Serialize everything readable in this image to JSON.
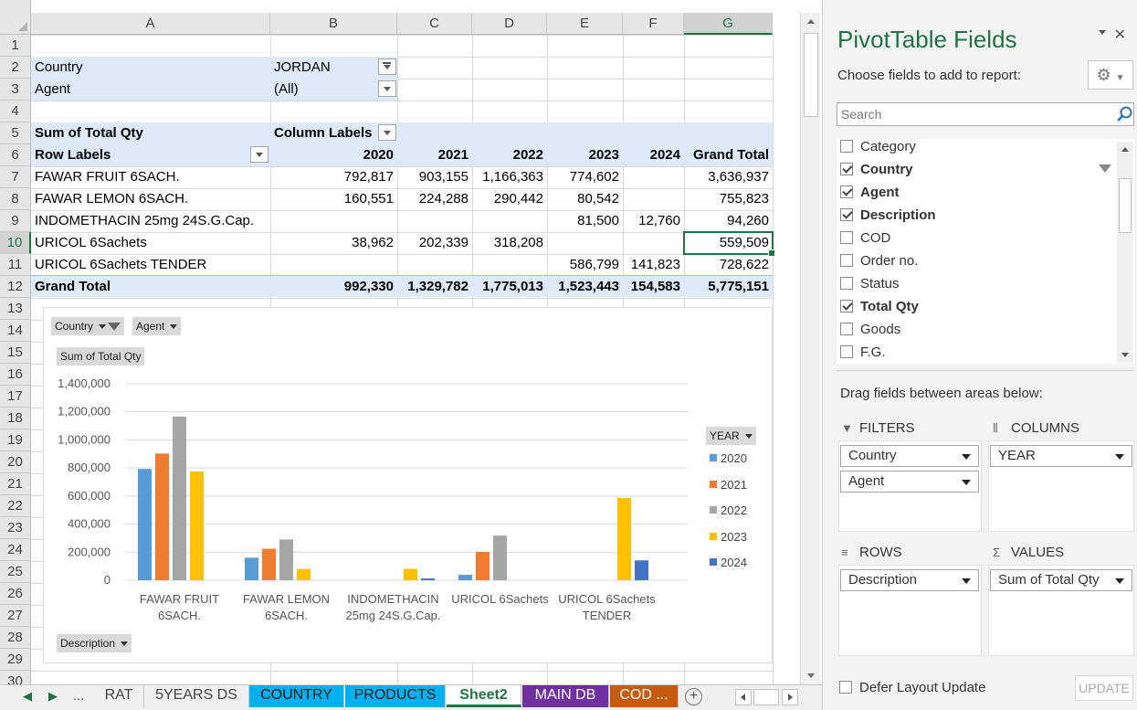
{
  "columns": [
    "A",
    "B",
    "C",
    "D",
    "E",
    "F",
    "G"
  ],
  "rows": [
    "1",
    "2",
    "3",
    "4",
    "5",
    "6",
    "7",
    "8",
    "9",
    "10",
    "11",
    "12",
    "13",
    "14",
    "15",
    "16",
    "17",
    "18",
    "19",
    "20",
    "21",
    "22",
    "23",
    "24",
    "25",
    "26",
    "27",
    "28",
    "29",
    "30"
  ],
  "filters": [
    {
      "label": "Country",
      "value": "JORDAN"
    },
    {
      "label": "Agent",
      "value": "(All)"
    }
  ],
  "pivot": {
    "sum_label": "Sum of Total Qty",
    "column_labels": "Column Labels",
    "row_labels": "Row Labels",
    "years": [
      "2020",
      "2021",
      "2022",
      "2023",
      "2024"
    ],
    "grand_total_header": "Grand Total",
    "rows": [
      {
        "label": "FAWAR FRUIT 6SACH.",
        "values": [
          "792,817",
          "903,155",
          "1,166,363",
          "774,602",
          ""
        ],
        "total": "3,636,937"
      },
      {
        "label": "FAWAR LEMON 6SACH.",
        "values": [
          "160,551",
          "224,288",
          "290,442",
          "80,542",
          ""
        ],
        "total": "755,823"
      },
      {
        "label": "INDOMETHACIN 25mg 24S.G.Cap.",
        "values": [
          "",
          "",
          "",
          "81,500",
          "12,760"
        ],
        "total": "94,260"
      },
      {
        "label": "URICOL 6Sachets",
        "values": [
          "38,962",
          "202,339",
          "318,208",
          "",
          ""
        ],
        "total": "559,509"
      },
      {
        "label": "URICOL 6Sachets  TENDER",
        "values": [
          "",
          "",
          "",
          "586,799",
          "141,823"
        ],
        "total": "728,622"
      }
    ],
    "grand_total": {
      "label": "Grand Total",
      "values": [
        "992,330",
        "1,329,782",
        "1,775,013",
        "1,523,443",
        "154,583"
      ],
      "total": "5,775,151"
    }
  },
  "chart_buttons": {
    "country": "Country",
    "agent": "Agent",
    "sum": "Sum of Total Qty",
    "year": "YEAR",
    "description": "Description"
  },
  "chart_data": {
    "type": "bar",
    "title": "",
    "categories": [
      "FAWAR FRUIT 6SACH.",
      "FAWAR LEMON 6SACH.",
      "INDOMETHACIN 25mg 24S.G.Cap.",
      "URICOL 6Sachets",
      "URICOL 6Sachets TENDER"
    ],
    "category_lines": [
      [
        "FAWAR FRUIT",
        "6SACH."
      ],
      [
        "FAWAR LEMON",
        "6SACH."
      ],
      [
        "INDOMETHACIN",
        "25mg 24S.G.Cap."
      ],
      [
        "URICOL 6Sachets",
        ""
      ],
      [
        "URICOL 6Sachets",
        "TENDER"
      ]
    ],
    "series": [
      {
        "name": "2020",
        "color": "#5b9bd5",
        "values": [
          792817,
          160551,
          0,
          38962,
          0
        ]
      },
      {
        "name": "2021",
        "color": "#ed7d31",
        "values": [
          903155,
          224288,
          0,
          202339,
          0
        ]
      },
      {
        "name": "2022",
        "color": "#a5a5a5",
        "values": [
          1166363,
          290442,
          0,
          318208,
          0
        ]
      },
      {
        "name": "2023",
        "color": "#ffc000",
        "values": [
          774602,
          80542,
          81500,
          0,
          586799
        ]
      },
      {
        "name": "2024",
        "color": "#4472c4",
        "values": [
          0,
          0,
          12760,
          0,
          141823
        ]
      }
    ],
    "yticks": [
      "0",
      "200,000",
      "400,000",
      "600,000",
      "800,000",
      "1,000,000",
      "1,200,000",
      "1,400,000"
    ],
    "ylim": [
      0,
      1400000
    ],
    "grid": true,
    "legend_position": "right"
  },
  "tabs": {
    "nav_prev": "◀",
    "nav_next": "▶",
    "more_left": "...",
    "items": [
      {
        "label": "RAT",
        "color": ""
      },
      {
        "label": "5YEARS DS",
        "color": ""
      },
      {
        "label": "COUNTRY",
        "color": "#00b0f0"
      },
      {
        "label": "PRODUCTS",
        "color": "#00b0f0"
      },
      {
        "label": "Sheet2",
        "color": "",
        "active": true
      },
      {
        "label": "MAIN DB",
        "color": "#7030a0"
      },
      {
        "label": "COD ...",
        "color": "#c55a11"
      }
    ],
    "add": "+"
  },
  "panel": {
    "title": "PivotTable Fields",
    "close": "✕",
    "choose": "Choose fields to add to report:",
    "search_placeholder": "Search",
    "fields": [
      {
        "label": "Category",
        "checked": false
      },
      {
        "label": "Country",
        "checked": true
      },
      {
        "label": "Agent",
        "checked": true
      },
      {
        "label": "Description",
        "checked": true
      },
      {
        "label": "COD",
        "checked": false
      },
      {
        "label": "Order no.",
        "checked": false
      },
      {
        "label": "Status",
        "checked": false
      },
      {
        "label": "Total Qty",
        "checked": true
      },
      {
        "label": "Goods",
        "checked": false
      },
      {
        "label": "F.G.",
        "checked": false
      }
    ],
    "drag_label": "Drag fields between areas below:",
    "areas": {
      "filters": {
        "title": "FILTERS",
        "items": [
          "Country",
          "Agent"
        ]
      },
      "columns": {
        "title": "COLUMNS",
        "items": [
          "YEAR"
        ]
      },
      "rows": {
        "title": "ROWS",
        "items": [
          "Description"
        ]
      },
      "values": {
        "title": "VALUES",
        "items": [
          "Sum of Total Qty"
        ]
      }
    },
    "defer": "Defer Layout Update",
    "update": "UPDATE"
  }
}
